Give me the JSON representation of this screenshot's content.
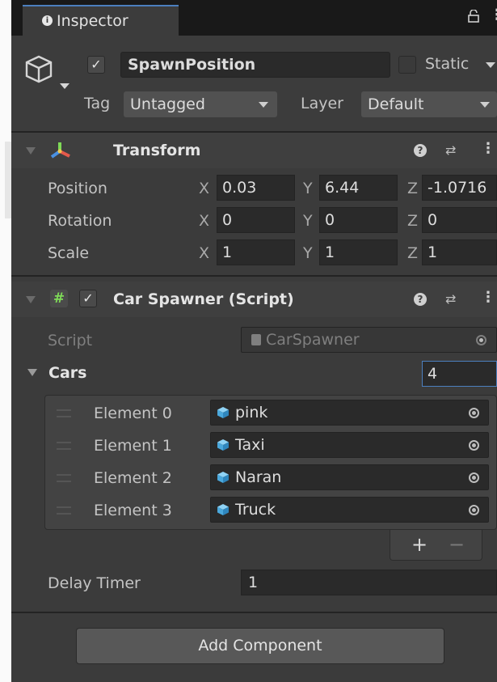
{
  "tab": {
    "title": "Inspector"
  },
  "object": {
    "name": "SpawnPosition",
    "active": true,
    "static_label": "Static",
    "tag_label": "Tag",
    "tag_value": "Untagged",
    "layer_label": "Layer",
    "layer_value": "Default"
  },
  "transform": {
    "title": "Transform",
    "rows": [
      {
        "label": "Position",
        "x": "0.03",
        "y": "6.44",
        "z": "-1.0716"
      },
      {
        "label": "Rotation",
        "x": "0",
        "y": "0",
        "z": "0"
      },
      {
        "label": "Scale",
        "x": "1",
        "y": "1",
        "z": "1"
      }
    ],
    "axes": {
      "x": "X",
      "y": "Y",
      "z": "Z"
    }
  },
  "car_spawner": {
    "title": "Car Spawner (Script)",
    "enabled": true,
    "script_label": "Script",
    "script_value": "CarSpawner",
    "cars_label": "Cars",
    "cars_count": "4",
    "elements": [
      {
        "label": "Element 0",
        "value": "pink"
      },
      {
        "label": "Element 1",
        "value": "Taxi"
      },
      {
        "label": "Element 2",
        "value": "Naran"
      },
      {
        "label": "Element 3",
        "value": "Truck"
      }
    ],
    "plus": "+",
    "minus": "−",
    "delay_label": "Delay Timer",
    "delay_value": "1"
  },
  "add_component": "Add Component",
  "icons": {
    "lock": "lock-icon",
    "menu": "kebab-menu-icon",
    "help": "help-icon",
    "preset": "preset-icon",
    "transform": "transform-axes-icon",
    "script": "script-hash-icon",
    "prefab": "prefab-cube-icon",
    "object_picker": "object-picker-icon",
    "gameobject": "gameobject-cube-icon"
  },
  "colors": {
    "panel": "#3c3c3c",
    "field": "#2a2a2a",
    "accent": "#4c7fbf",
    "prefab": "#5bb7e8"
  }
}
